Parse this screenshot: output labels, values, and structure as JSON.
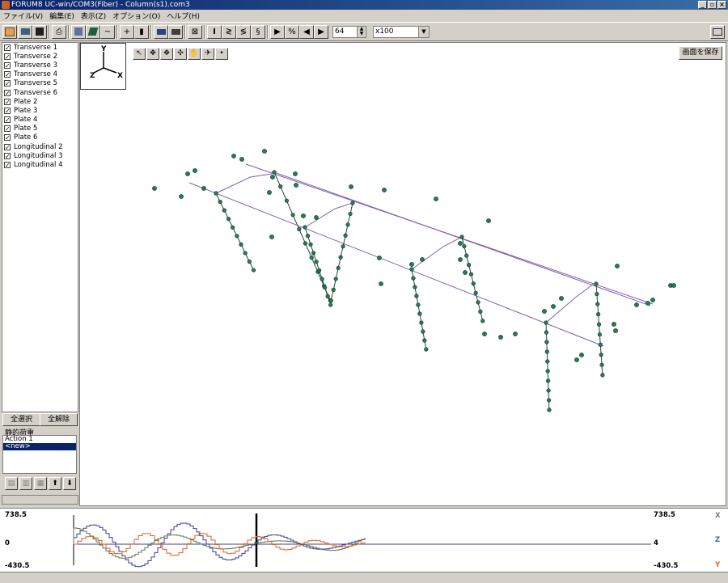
{
  "window": {
    "title": "FORUM8  UC-win/COM3(Fiber) - Column(s1).com3",
    "buttons": [
      "_",
      "▫",
      "×"
    ]
  },
  "menu": [
    "ファイル(V)",
    "編集(E)",
    "表示(Z)",
    "オプション(O)",
    "ヘルプ(H)"
  ],
  "toolbar": {
    "frame_value": "64",
    "scale_value": "x100"
  },
  "layers": [
    {
      "label": "Transverse 1",
      "checked": true
    },
    {
      "label": "Transverse 2",
      "checked": true
    },
    {
      "label": "Transverse 3",
      "checked": true
    },
    {
      "label": "Transverse 4",
      "checked": true
    },
    {
      "label": "Transverse 5",
      "checked": true
    },
    {
      "label": "Transverse 6",
      "checked": true
    },
    {
      "label": "Plate 2",
      "checked": true
    },
    {
      "label": "Plate 3",
      "checked": true
    },
    {
      "label": "Plate 4",
      "checked": true
    },
    {
      "label": "Plate 5",
      "checked": true
    },
    {
      "label": "Plate 6",
      "checked": true
    },
    {
      "label": "Longitudinal 2",
      "checked": true
    },
    {
      "label": "Longitudinal 3",
      "checked": true
    },
    {
      "label": "Longitudinal 4",
      "checked": true
    }
  ],
  "selection": {
    "select_all": "全選択",
    "deselect_all": "全解除"
  },
  "load_group": {
    "label": "静的荷重",
    "items": [
      {
        "label": "Action 1",
        "selected": false
      },
      {
        "label": "<new>",
        "selected": true
      }
    ]
  },
  "viewport": {
    "save_button": "画面を保存",
    "axes": {
      "x": "X",
      "y": "Y",
      "z": "Z"
    }
  },
  "graph": {
    "y_max_left": "738.5",
    "zero_left": "0",
    "y_min_left": "-430.5",
    "y_max_right": "738.5",
    "zero_right": "4",
    "y_min_right": "-430.5",
    "axis_x": "X",
    "axis_z": "Z",
    "axis_y": "Y",
    "colors": {
      "x": "#3c3c96",
      "z": "#5a7850",
      "y": "#e06020"
    }
  }
}
